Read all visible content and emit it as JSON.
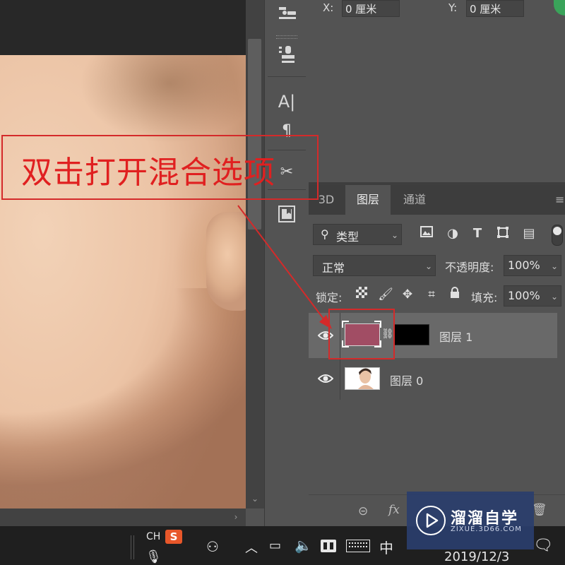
{
  "properties": {
    "x_label": "X:",
    "x_value": "0 厘米",
    "y_label": "Y:",
    "y_value": "0 厘米"
  },
  "toolbar": {
    "tools": [
      {
        "icon": "brush-settings-icon",
        "glyph": "⚙"
      },
      {
        "icon": "clone-stamp-icon",
        "glyph": "⊥"
      },
      {
        "icon": "character-icon",
        "glyph": "A|"
      },
      {
        "icon": "paragraph-icon",
        "glyph": "¶"
      },
      {
        "icon": "tool-presets-icon",
        "glyph": "⚒"
      },
      {
        "icon": "navigator-icon",
        "glyph": "◧"
      }
    ]
  },
  "layers_panel": {
    "tabs": [
      {
        "label": "3D",
        "active": false
      },
      {
        "label": "图层",
        "active": true
      },
      {
        "label": "通道",
        "active": false
      }
    ],
    "filter_kind": "类型",
    "blend_mode": "正常",
    "opacity_label": "不透明度:",
    "opacity_value": "100%",
    "lock_label": "锁定:",
    "fill_label": "填充:",
    "fill_value": "100%",
    "layers": [
      {
        "name": "图层 1",
        "visible": true,
        "selected": true,
        "color": "#a14d64",
        "has_mask": true
      },
      {
        "name": "图层 0",
        "visible": true,
        "selected": false
      }
    ],
    "bottom_fx": "fx"
  },
  "annotation": {
    "text": "双击打开混合选项",
    "color": "#d42a2a"
  },
  "taskbar": {
    "ime_lang": "CH",
    "ime_logo": "S",
    "ime_mode": "中",
    "date": "2019/12/3"
  },
  "watermark": {
    "title": "溜溜自学",
    "url": "ZIXUE.3D66.COM"
  }
}
